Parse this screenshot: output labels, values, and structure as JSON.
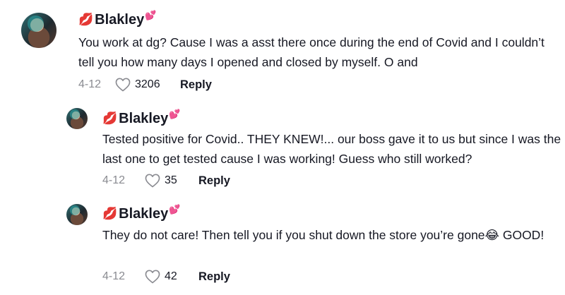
{
  "comments": [
    {
      "username": "Blakley",
      "lips_icon": "💋",
      "hearts_icon": "💕",
      "text": "You work at dg? Cause I was a asst there once during the end of Covid and I couldn’t tell you how many days I opened and closed by myself. O and",
      "date": "4-12",
      "likes": "3206",
      "reply_label": "Reply"
    },
    {
      "username": "Blakley",
      "lips_icon": "💋",
      "hearts_icon": "💕",
      "text": "Tested positive for Covid.. THEY KNEW!... our boss gave it to us but since I was the last one to get tested cause I was working! Guess who still worked?",
      "date": "4-12",
      "likes": "35",
      "reply_label": "Reply"
    },
    {
      "username": "Blakley",
      "lips_icon": "💋",
      "hearts_icon": "💕",
      "text": "They do not care! Then tell you if you shut down the store you’re gone😂 GOOD!",
      "date": "4-12",
      "likes": "42",
      "reply_label": "Reply"
    }
  ]
}
